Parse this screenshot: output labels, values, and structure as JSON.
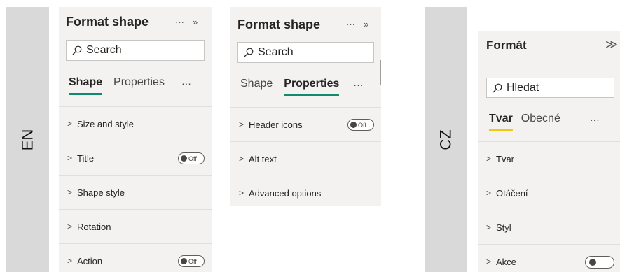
{
  "labels": {
    "en": "EN",
    "cz": "CZ"
  },
  "panel_en_shape": {
    "title": "Format shape",
    "more": "···",
    "expand": "»",
    "search_placeholder": "Search",
    "tabs": {
      "shape": "Shape",
      "properties": "Properties",
      "more": "···"
    },
    "rows": [
      {
        "label": "Size and style",
        "toggle": ""
      },
      {
        "label": "Title",
        "toggle": "Off"
      },
      {
        "label": "Shape style",
        "toggle": ""
      },
      {
        "label": "Rotation",
        "toggle": ""
      },
      {
        "label": "Action",
        "toggle": "Off"
      }
    ]
  },
  "panel_en_properties": {
    "title": "Format shape",
    "more": "···",
    "expand": "»",
    "search_placeholder": "Search",
    "tabs": {
      "shape": "Shape",
      "properties": "Properties",
      "more": "···"
    },
    "rows": [
      {
        "label": "Header icons",
        "toggle": "Off"
      },
      {
        "label": "Alt text",
        "toggle": ""
      },
      {
        "label": "Advanced options",
        "toggle": ""
      }
    ]
  },
  "panel_cz": {
    "title": "Formát",
    "expand": "≫",
    "search_placeholder": "Hledat",
    "tabs": {
      "shape": "Tvar",
      "general": "Obecné",
      "more": "···"
    },
    "rows": [
      {
        "label": "Tvar"
      },
      {
        "label": "Otáčení"
      },
      {
        "label": "Styl"
      },
      {
        "label": "Akce"
      }
    ]
  },
  "colors": {
    "accent_underline": "#118a6e",
    "accent_underline_cz": "#f2c811",
    "panel_bg": "#f3f2f1"
  }
}
